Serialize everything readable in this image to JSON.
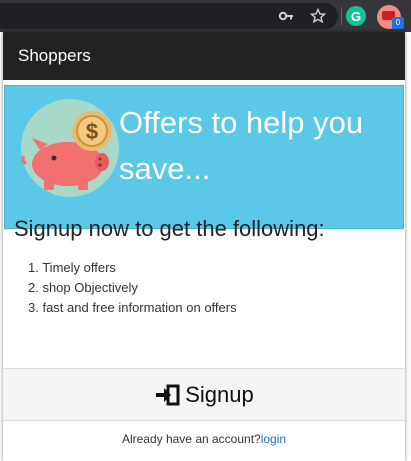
{
  "browser": {
    "grammarly_letter": "G",
    "extension_badge": "0"
  },
  "popup": {
    "title": "Shoppers",
    "hero_text": "Offers to help you save...",
    "signup_heading": "Signup now to get the following:",
    "benefits": [
      "1. Timely offers",
      "2. shop Objectively",
      "3. fast and free information on offers"
    ],
    "signup_label": "Signup",
    "account_prompt": "Already have an account?",
    "login_label": "login"
  },
  "colors": {
    "hero_bg": "#5bc8e8",
    "header_bg": "#222222",
    "piggy": "#f27070",
    "coin": "#e9bb6a",
    "link": "#1a73c8"
  }
}
